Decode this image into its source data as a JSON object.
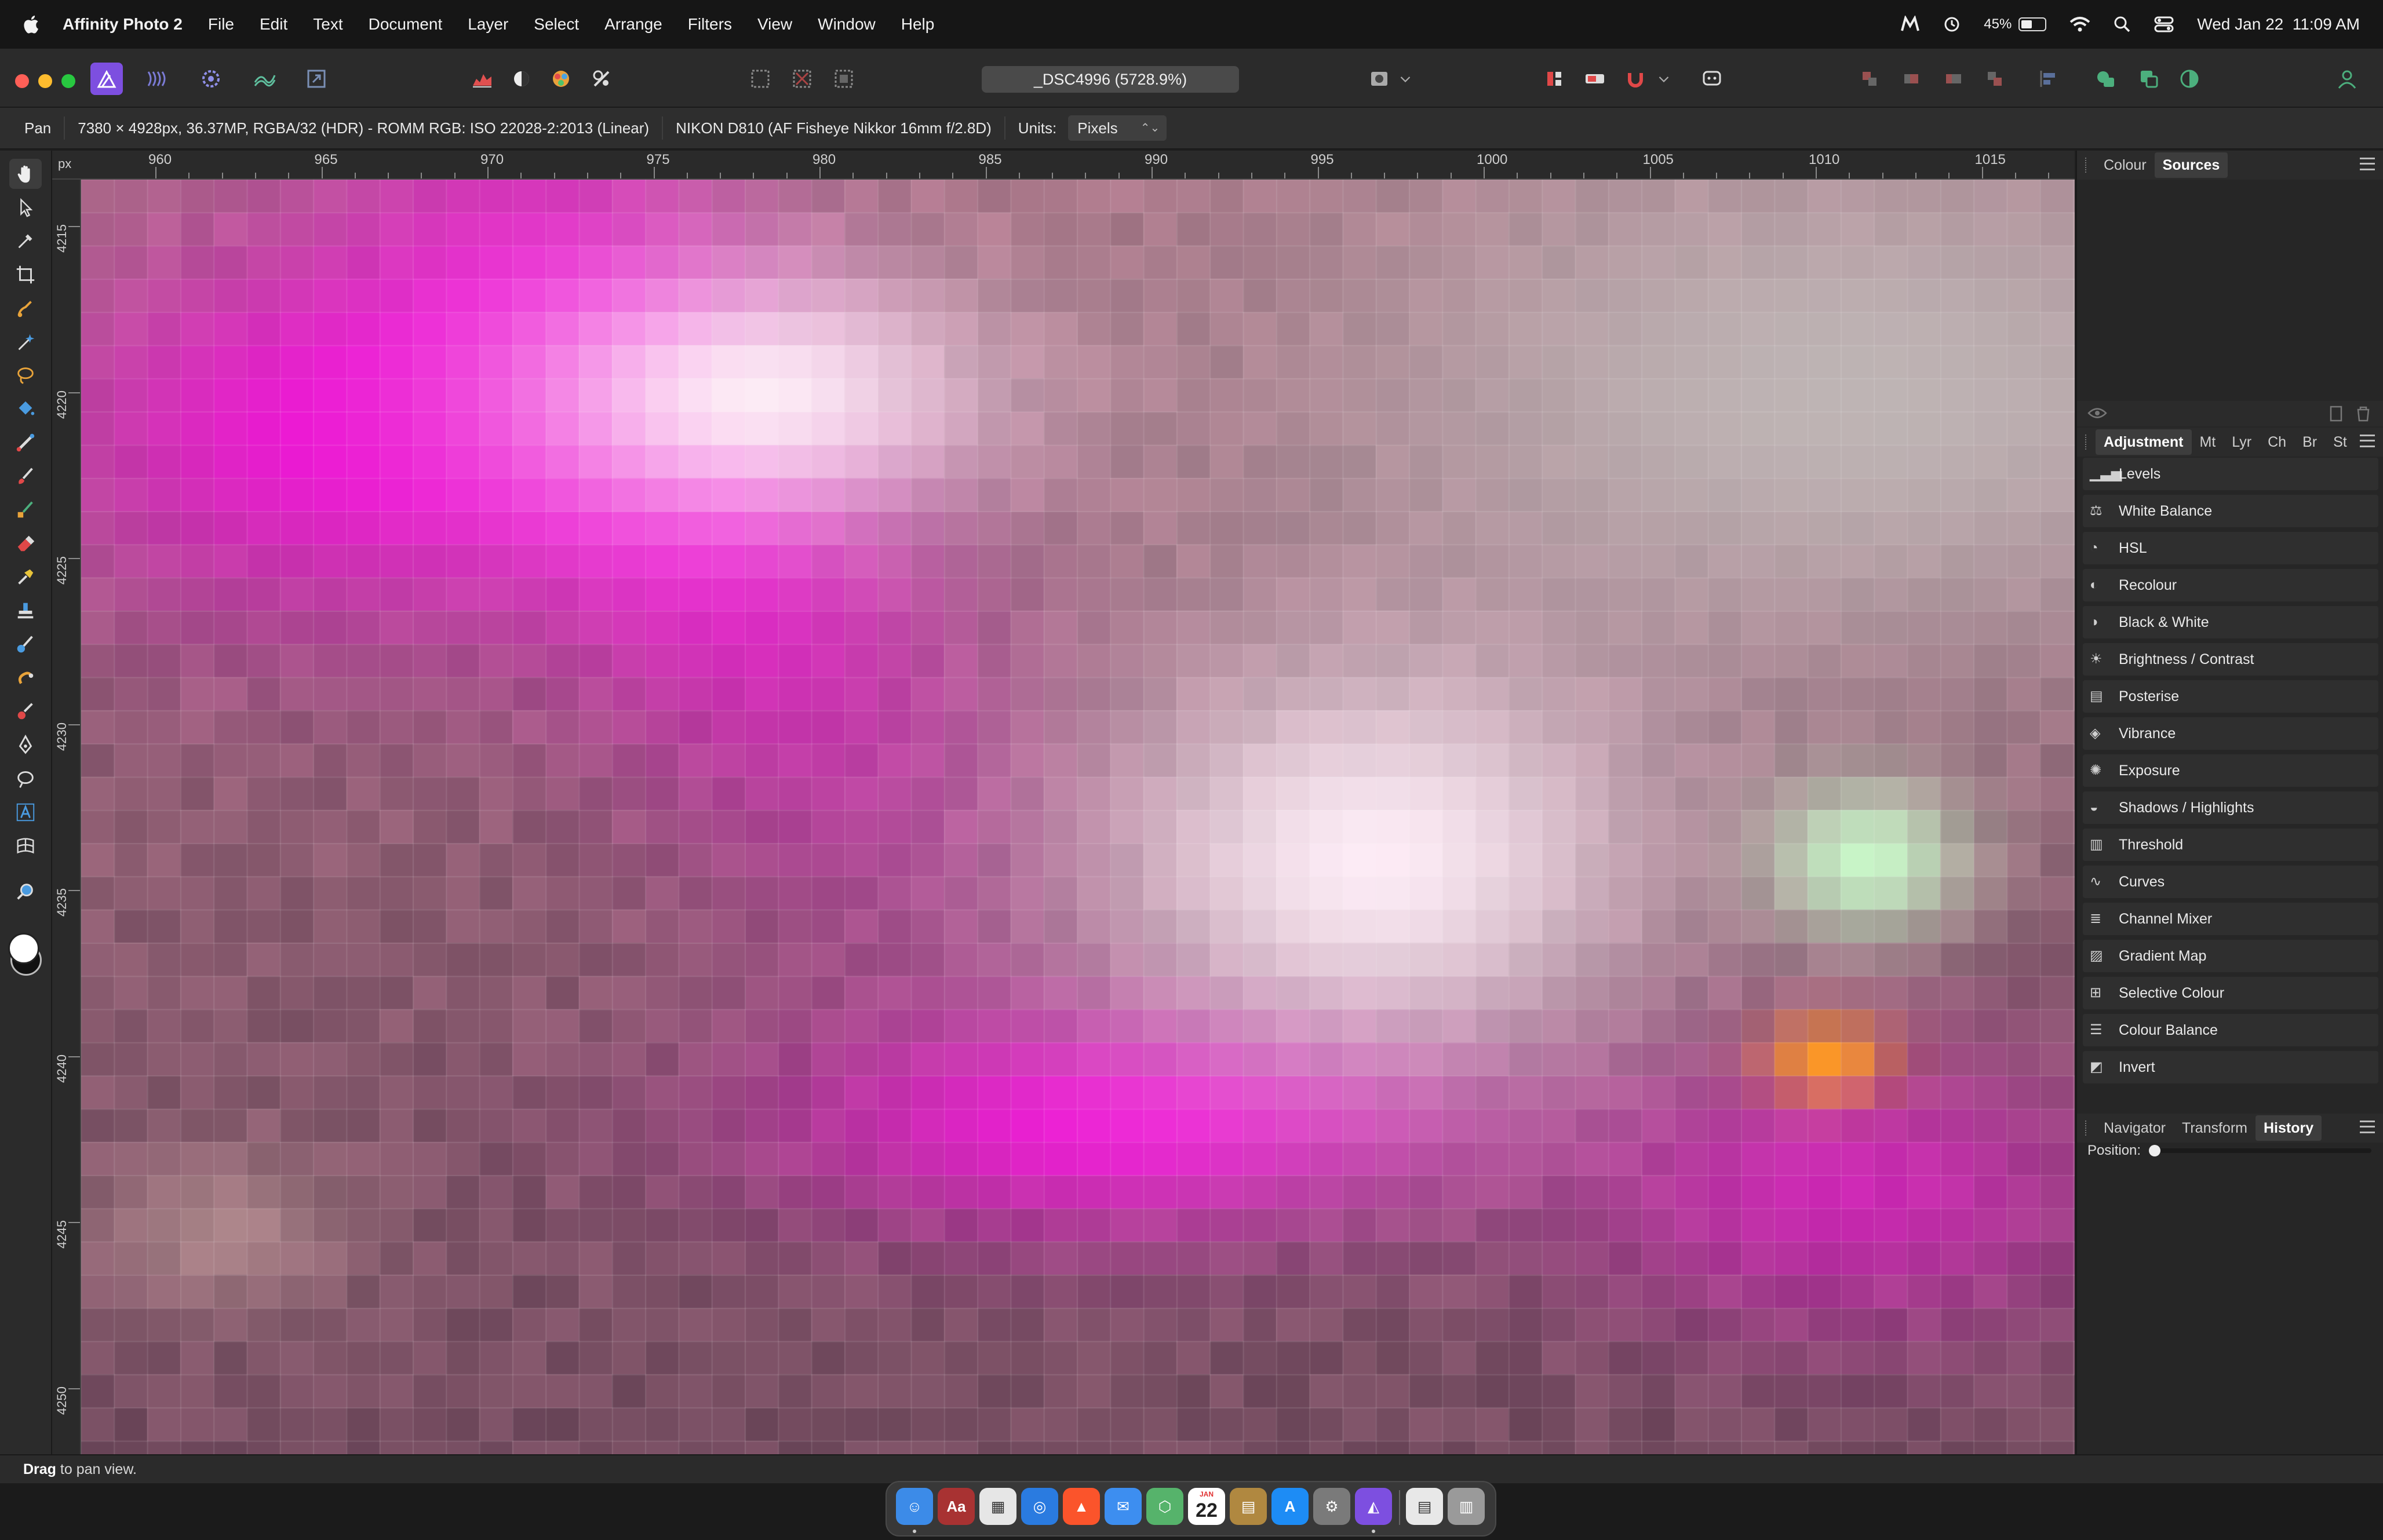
{
  "menubar": {
    "app_name": "Affinity Photo 2",
    "menus": [
      "File",
      "Edit",
      "Text",
      "Document",
      "Layer",
      "Select",
      "Arrange",
      "Filters",
      "View",
      "Window",
      "Help"
    ],
    "battery_percent": "45%",
    "battery_level": 0.45,
    "datetime": "Wed Jan 22  11:09 AM"
  },
  "document": {
    "title": "_DSC4996 (5728.9%)"
  },
  "context_bar": {
    "tool": "Pan",
    "image_info": "7380 × 4928px, 36.37MP, RGBA/32 (HDR) - ROMM RGB: ISO 22028-2:2013 (Linear)",
    "camera_info": "NIKON D810 (AF Fisheye Nikkor 16mm f/2.8D)",
    "units_label": "Units:",
    "units_value": "Pixels"
  },
  "rulers": {
    "unit": "px",
    "top_labels": [
      "960",
      "965",
      "970",
      "975",
      "980",
      "985",
      "990",
      "995",
      "1000",
      "1005",
      "1010",
      "1015"
    ],
    "left_labels": [
      "4215",
      "4220",
      "4225",
      "4230",
      "4235",
      "4240",
      "4245",
      "4250"
    ]
  },
  "colours": {
    "accent": "#8a5cf6",
    "panel_bg": "#262626",
    "toolbar_bg": "#2b2b2b"
  },
  "right_panel": {
    "top_tabs": [
      "Colour",
      "Sources"
    ],
    "top_active": "Sources",
    "studio_tabs": [
      "Adjustment",
      "Mt",
      "Lyr",
      "Ch",
      "Br",
      "St"
    ],
    "studio_active": "Adjustment",
    "adjustments": [
      "Levels",
      "White Balance",
      "HSL",
      "Recolour",
      "Black & White",
      "Brightness / Contrast",
      "Posterise",
      "Vibrance",
      "Exposure",
      "Shadows / Highlights",
      "Threshold",
      "Curves",
      "Channel Mixer",
      "Gradient Map",
      "Selective Colour",
      "Colour Balance",
      "Invert"
    ],
    "bottom_tabs": [
      "Navigator",
      "Transform",
      "History"
    ],
    "bottom_active": "History",
    "history_position_label": "Position:",
    "history_position": 0.0
  },
  "statusbar": {
    "bold": "Drag",
    "rest": " to pan view."
  },
  "dock": {
    "apps": [
      "Finder",
      "Dictionary",
      "Launchpad",
      "Safari",
      "Brave",
      "Mail",
      "Maps",
      "Calendar",
      "Notes",
      "App Store",
      "System Settings",
      "Affinity Photo 2",
      "Documents",
      "Trash"
    ],
    "calendar_month": "JAN",
    "calendar_day": "22"
  }
}
